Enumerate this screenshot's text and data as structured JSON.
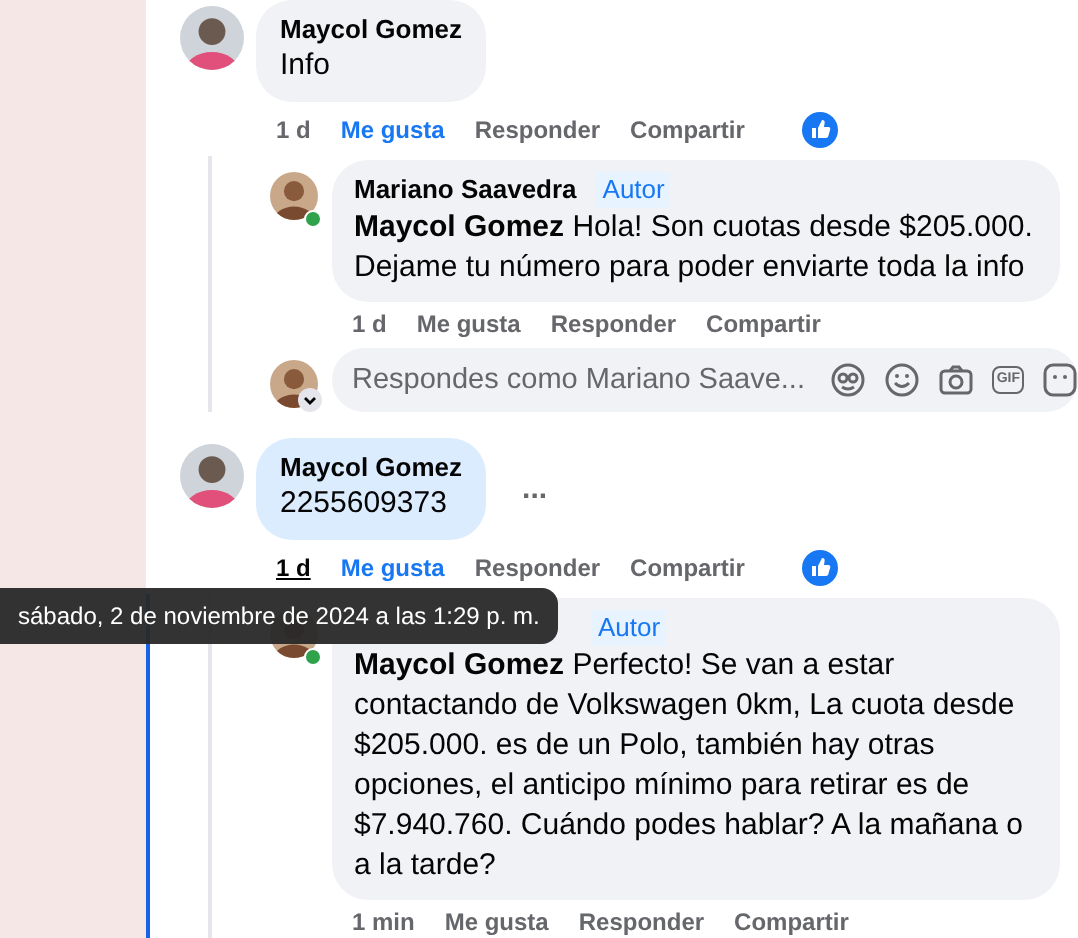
{
  "threads": [
    {
      "comment": {
        "author": "Maycol Gomez",
        "text": "Info",
        "highlighted": false,
        "actions": {
          "time": "1 d",
          "time_hovered": false,
          "like": "Me gusta",
          "liked": true,
          "reply": "Responder",
          "share": "Compartir",
          "reaction_shown": true
        }
      },
      "replies": [
        {
          "author": "Mariano Saavedra",
          "badge": "Autor",
          "online": true,
          "text": "**Maycol Gomez** Hola! Son cuotas desde $205.000. Dejame tu número para poder enviarte toda la info",
          "actions": {
            "time": "1 d",
            "time_hovered": false,
            "like": "Me gusta",
            "liked": false,
            "reply": "Responder",
            "share": "Compartir"
          }
        }
      ],
      "composer": {
        "placeholder": "Respondes como Mariano Saave...",
        "gif_label": "GIF"
      },
      "marked": false
    },
    {
      "comment": {
        "author": "Maycol Gomez",
        "text": "2255609373",
        "highlighted": true,
        "menu": "...",
        "actions": {
          "time": "1 d",
          "time_hovered": true,
          "like": "Me gusta",
          "liked": true,
          "reply": "Responder",
          "share": "Compartir",
          "reaction_shown": true
        }
      },
      "replies": [
        {
          "badge": "Autor",
          "online": true,
          "text": "**Maycol Gomez** Perfecto! Se van a estar contactando de Volkswagen 0km, La cuota desde $205.000. es de un Polo, también hay otras opciones, el anticipo mínimo para retirar es de $7.940.760. Cuándo podes hablar? A la mañana o a la tarde?",
          "actions": {
            "time": "1 min",
            "time_hovered": false,
            "like": "Me gusta",
            "liked": false,
            "reply": "Responder",
            "share": "Compartir"
          }
        }
      ],
      "marked": true
    }
  ],
  "tooltip": {
    "text": "sábado, 2 de noviembre de 2024 a las 1:29 p. m."
  }
}
